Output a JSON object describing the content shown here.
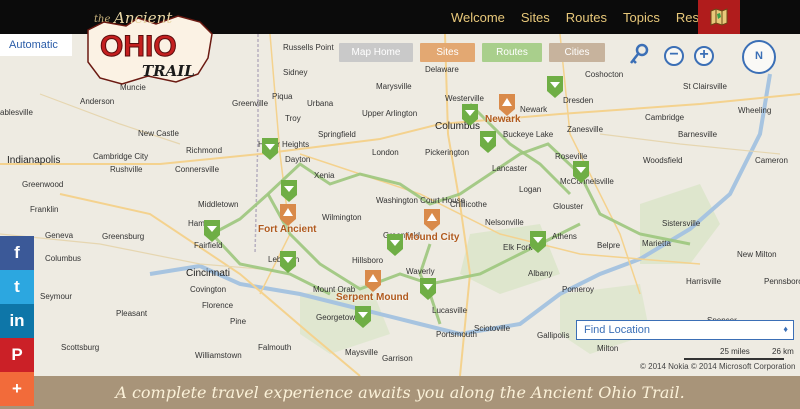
{
  "nav": {
    "items": [
      {
        "label": "Welcome"
      },
      {
        "label": "Sites"
      },
      {
        "label": "Routes"
      },
      {
        "label": "Topics"
      },
      {
        "label": "Resources"
      }
    ],
    "map_icon": "ohio-map-icon"
  },
  "logo": {
    "the": "the",
    "ancient": "Ancient",
    "ohio": "OHIO",
    "trail": "TRAIL"
  },
  "map": {
    "auto_label": "Automatic",
    "buttons": {
      "home": "Map Home",
      "sites": "Sites",
      "routes": "Routes",
      "cities": "Cities"
    },
    "zoom_out": "−",
    "zoom_in": "+",
    "compass": "N",
    "find_location": "Find Location",
    "scale": {
      "miles": "25 miles",
      "km": "26 km"
    },
    "copyright": "© 2014 Nokia  © 2014 Microsoft Corporation",
    "colors": {
      "route": "#9cc77d",
      "site_pin": "#d98a4a",
      "route_pin": "#6fae45"
    },
    "cities": [
      {
        "name": "Russells Point"
      },
      {
        "name": "Delaware"
      },
      {
        "name": "Coshocton"
      },
      {
        "name": "Sidney"
      },
      {
        "name": "Marysville"
      },
      {
        "name": "Muncie"
      },
      {
        "name": "Piqua"
      },
      {
        "name": "Urbana"
      },
      {
        "name": "Westerville"
      },
      {
        "name": "Newark"
      },
      {
        "name": "Dresden"
      },
      {
        "name": "Anderson"
      },
      {
        "name": "Greenville"
      },
      {
        "name": "Troy"
      },
      {
        "name": "Upper Arlington"
      },
      {
        "name": "Columbus"
      },
      {
        "name": "Zanesville"
      },
      {
        "name": "St Clairsville"
      },
      {
        "name": "Wheeling"
      },
      {
        "name": "ablesville"
      },
      {
        "name": "Buckeye Lake"
      },
      {
        "name": "Cambridge"
      },
      {
        "name": "Barnesville"
      },
      {
        "name": "New Castle"
      },
      {
        "name": "Springfield"
      },
      {
        "name": "Huber Heights"
      },
      {
        "name": "Richmond"
      },
      {
        "name": "London"
      },
      {
        "name": "Pickerington"
      },
      {
        "name": "Indianapolis"
      },
      {
        "name": "Cambridge City"
      },
      {
        "name": "Connersville"
      },
      {
        "name": "Rushville"
      },
      {
        "name": "Dayton"
      },
      {
        "name": "Xenia"
      },
      {
        "name": "Lancaster"
      },
      {
        "name": "Roseville"
      },
      {
        "name": "McConnelsville"
      },
      {
        "name": "Woodsfield"
      },
      {
        "name": "Cameron"
      },
      {
        "name": "Greenwood"
      },
      {
        "name": "Middletown"
      },
      {
        "name": "Washington Court House"
      },
      {
        "name": "Chillicothe"
      },
      {
        "name": "Wilmington"
      },
      {
        "name": "Logan"
      },
      {
        "name": "Glouster"
      },
      {
        "name": "Nelsonville"
      },
      {
        "name": "Sistersville"
      },
      {
        "name": "Franklin"
      },
      {
        "name": "Fairfield"
      },
      {
        "name": "Hamilton"
      },
      {
        "name": "Marietta"
      },
      {
        "name": "Greensburg"
      },
      {
        "name": "Geneva"
      },
      {
        "name": "Greenfield"
      },
      {
        "name": "Athens"
      },
      {
        "name": "Elk Fork"
      },
      {
        "name": "Belpre"
      },
      {
        "name": "New Milton"
      },
      {
        "name": "Columbus"
      },
      {
        "name": "Lebanon"
      },
      {
        "name": "Cincinnati"
      },
      {
        "name": "Covington"
      },
      {
        "name": "Hillsboro"
      },
      {
        "name": "Waverly"
      },
      {
        "name": "Albany"
      },
      {
        "name": "Pomeroy"
      },
      {
        "name": "Harrisville"
      },
      {
        "name": "Pennsboro"
      },
      {
        "name": "Seymour"
      },
      {
        "name": "Florence"
      },
      {
        "name": "Mount Orab"
      },
      {
        "name": "Lucasville"
      },
      {
        "name": "Sciotoville"
      },
      {
        "name": "Pleasant"
      },
      {
        "name": "Georgetown"
      },
      {
        "name": "Portsmouth"
      },
      {
        "name": "Gallipolis"
      },
      {
        "name": "Spencer"
      },
      {
        "name": "Scottsburg"
      },
      {
        "name": "Falmouth"
      },
      {
        "name": "Williamstown"
      },
      {
        "name": "Maysville"
      },
      {
        "name": "Garrison"
      },
      {
        "name": "Milton"
      },
      {
        "name": "Pine"
      }
    ],
    "site_labels": [
      {
        "name": "Newark"
      },
      {
        "name": "Fort Ancient"
      },
      {
        "name": "Mound City"
      },
      {
        "name": "Serpent Mound"
      }
    ]
  },
  "social": {
    "facebook": "f",
    "twitter": "t",
    "linkedin": "in",
    "pinterest": "P",
    "plus": "+"
  },
  "footer": {
    "tagline": "A complete travel experience awaits you along the Ancient Ohio Trail."
  }
}
